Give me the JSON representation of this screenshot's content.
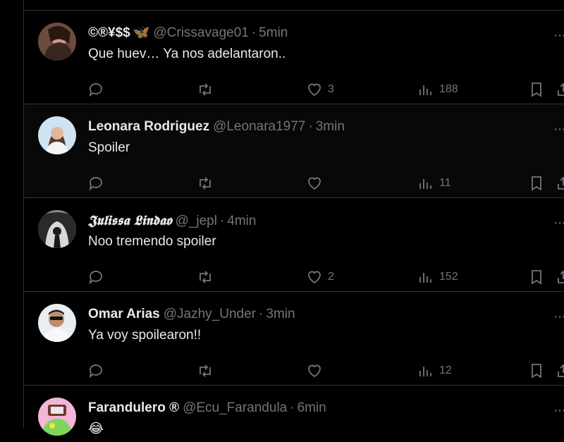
{
  "colors": {
    "background": "#000000",
    "text": "#e7e9ea",
    "muted": "#71767b",
    "border": "#2f3336",
    "accent": "#1d9bf0"
  },
  "icons": {
    "reply": "reply-icon",
    "retweet": "retweet-icon",
    "like": "heart-icon",
    "views": "views-icon",
    "bookmark": "bookmark-icon",
    "share": "share-icon",
    "more": "more-icon"
  },
  "tweets": [
    {
      "name": "©®¥$$",
      "badge": "🦋",
      "handle": "@Crissavage01",
      "sep": "·",
      "time": "5min",
      "text": "Que huev… Ya nos adelantaron..",
      "likes": "3",
      "views": "188"
    },
    {
      "name": "Leonara Rodriguez",
      "handle": "@Leonara1977",
      "sep": "·",
      "time": "3min",
      "text": "Spoiler",
      "likes": "",
      "views": "11"
    },
    {
      "name": "𝕵𝖚𝖑𝖎𝖘𝖘𝖆 𝕷𝖎𝖓𝖉𝖆𝖔",
      "handle": "@_jepl",
      "sep": "·",
      "time": "4min",
      "text": "Noo tremendo spoiler",
      "likes": "2",
      "views": "152"
    },
    {
      "name": "Omar Arias",
      "handle": "@Jazhy_Under",
      "sep": "·",
      "time": "3min",
      "text": "Ya voy spoilearon!!",
      "likes": "",
      "views": "12"
    },
    {
      "name": "Farandulero ®",
      "handle": "@Ecu_Farandula",
      "sep": "·",
      "time": "6min",
      "text": "😂",
      "likes": "",
      "views": ""
    }
  ]
}
